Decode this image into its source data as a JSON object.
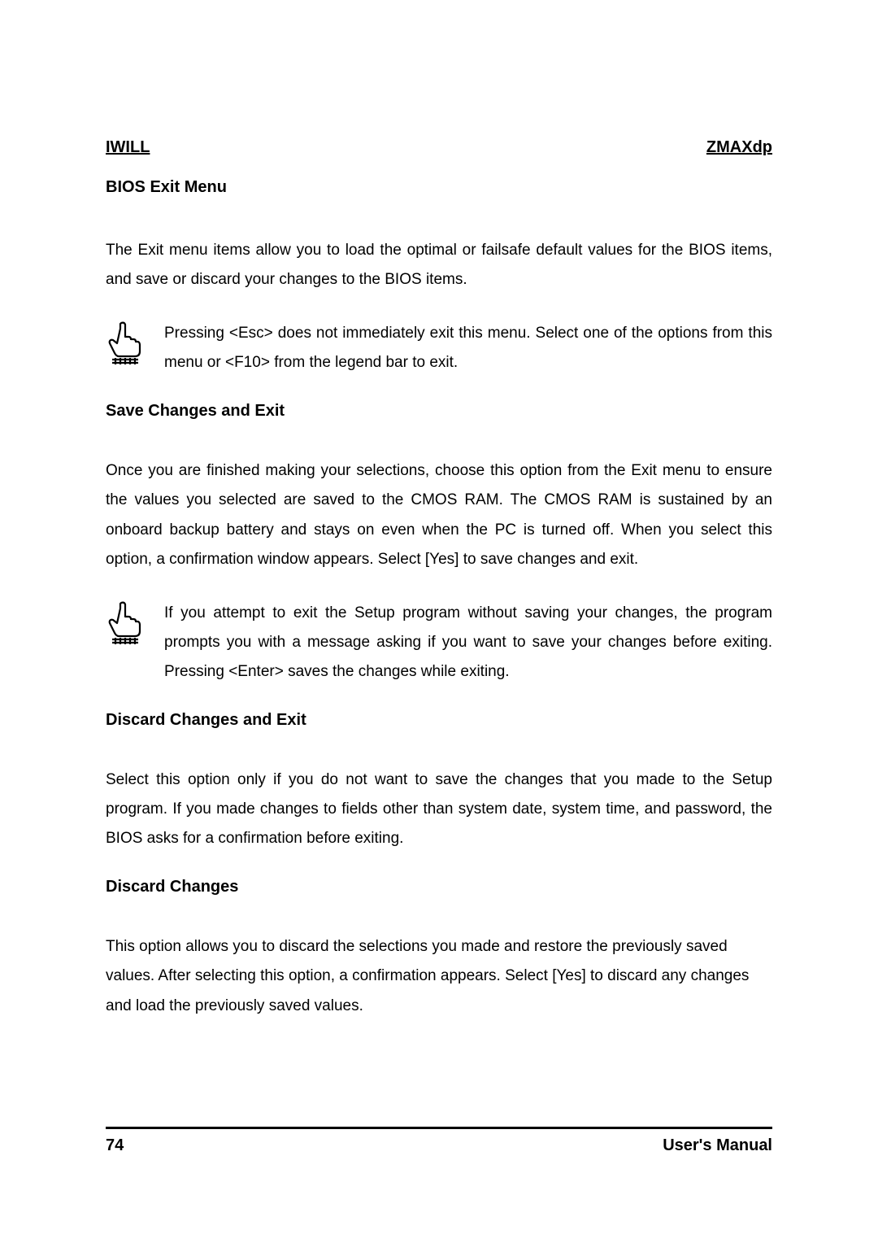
{
  "header": {
    "left": "IWILL",
    "right": "ZMAXdp"
  },
  "title": "BIOS Exit Menu",
  "intro": "The Exit menu items allow you to load the optimal or failsafe default values for the BIOS items, and save or discard your changes to the BIOS items.",
  "note1": "Pressing <Esc> does not immediately exit this menu. Select one of the options from this menu or <F10> from the legend bar to exit.",
  "section_save": {
    "heading": "Save Changes and Exit",
    "body": "Once you are finished making your selections, choose this option from the Exit menu to ensure the values you selected are saved to the CMOS RAM. The CMOS RAM is sustained by an onboard backup battery and stays on even when the PC is turned off. When you select this option, a confirmation window appears. Select [Yes] to save changes and exit.",
    "note": "If you attempt to exit the Setup program without saving your changes, the program prompts you with a message asking if you want to save your changes before exiting. Pressing <Enter> saves the changes while exiting."
  },
  "section_discard_exit": {
    "heading": "Discard Changes and Exit",
    "body": "Select this option only if you do not want to save the changes that you made to the Setup program. If you made changes to fields other than system date, system time, and password, the BIOS asks for a confirmation before exiting."
  },
  "section_discard": {
    "heading": "Discard Changes",
    "body": "This option allows you to discard the selections you made and restore the previously saved values. After selecting this option, a confirmation appears. Select [Yes] to discard any changes and load the previously saved values."
  },
  "footer": {
    "page": "74",
    "label": "User's  Manual"
  },
  "icons": {
    "pointer": "pointer-hand-icon"
  }
}
